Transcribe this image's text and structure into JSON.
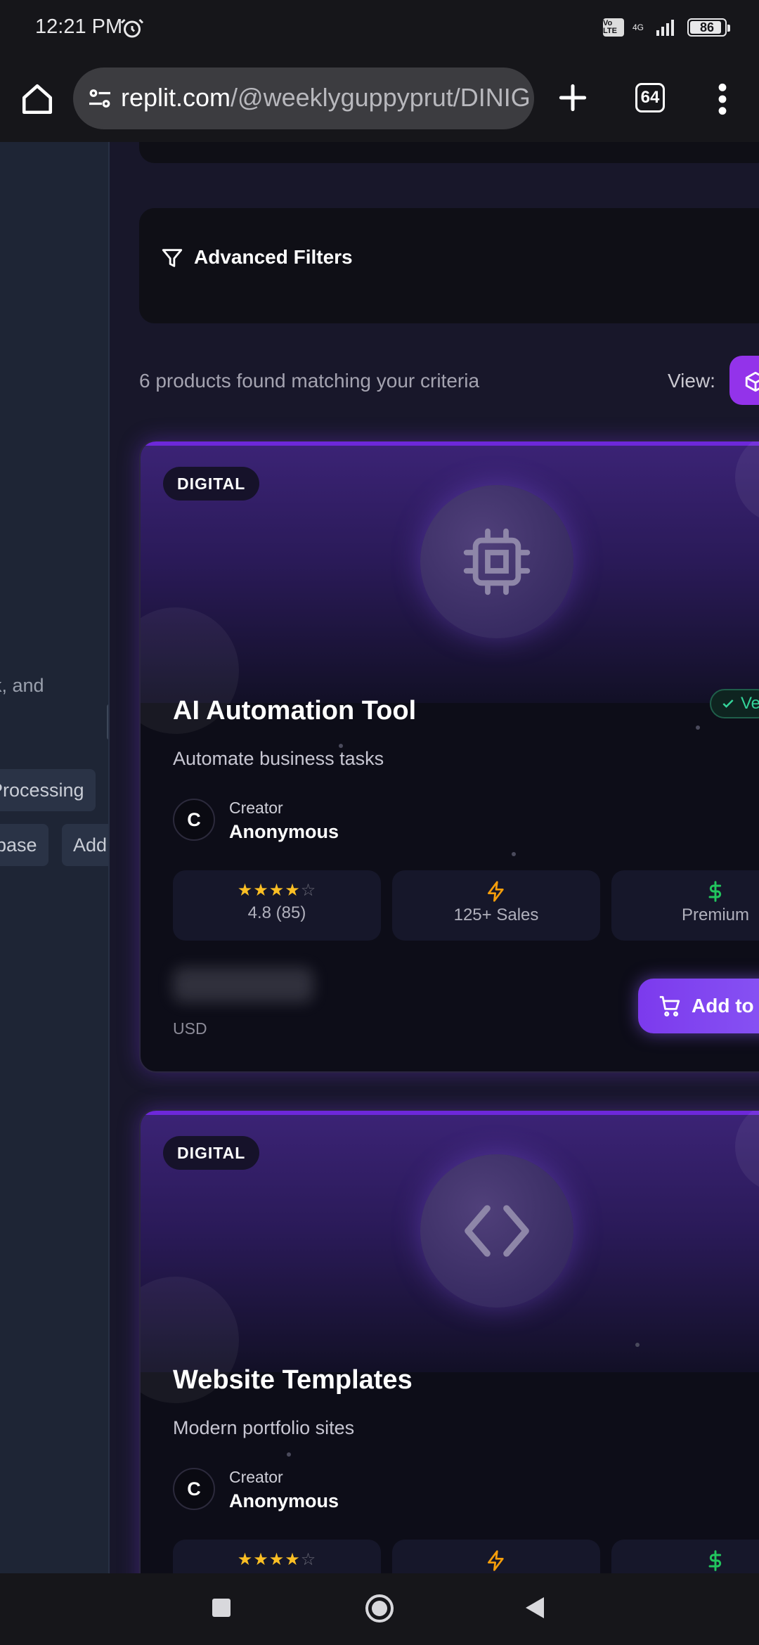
{
  "status_bar": {
    "time": "12:21 PM",
    "network_badge": "Vo LTE",
    "network": "4G",
    "battery": "86"
  },
  "browser": {
    "url_domain": "replit.com",
    "url_path": "/@weeklyguppyprut/DINIG",
    "tab_count": "64"
  },
  "sidebar": {
    "description_fragment": "rk, and",
    "chips": [
      "Processing",
      "base",
      "Add"
    ]
  },
  "filters": {
    "label": "Advanced Filters"
  },
  "results": {
    "count_text": "6 products found matching your criteria",
    "view_label": "View:"
  },
  "products": [
    {
      "badge": "DIGITAL",
      "title": "AI Automation Tool",
      "subtitle": "Automate business tasks",
      "verified": "Ve",
      "creator_initial": "C",
      "creator_label": "Creator",
      "creator_name": "Anonymous",
      "stars": "★★★★",
      "stars_empty": "☆",
      "rating": "4.8 (85)",
      "sales": "125+ Sales",
      "tier": "Premium",
      "currency": "USD",
      "cart_label": "Add to C",
      "icon": "cpu-chip-icon"
    },
    {
      "badge": "DIGITAL",
      "title": "Website Templates",
      "subtitle": "Modern portfolio sites",
      "creator_initial": "C",
      "creator_label": "Creator",
      "creator_name": "Anonymous",
      "stars": "★★★★",
      "stars_empty": "☆",
      "icon": "code-brackets-icon"
    }
  ],
  "colors": {
    "accent": "#7c3aed",
    "star": "#fbbf24",
    "verified": "#34d399",
    "sales_icon": "#f59e0b",
    "price_icon": "#22c55e"
  }
}
